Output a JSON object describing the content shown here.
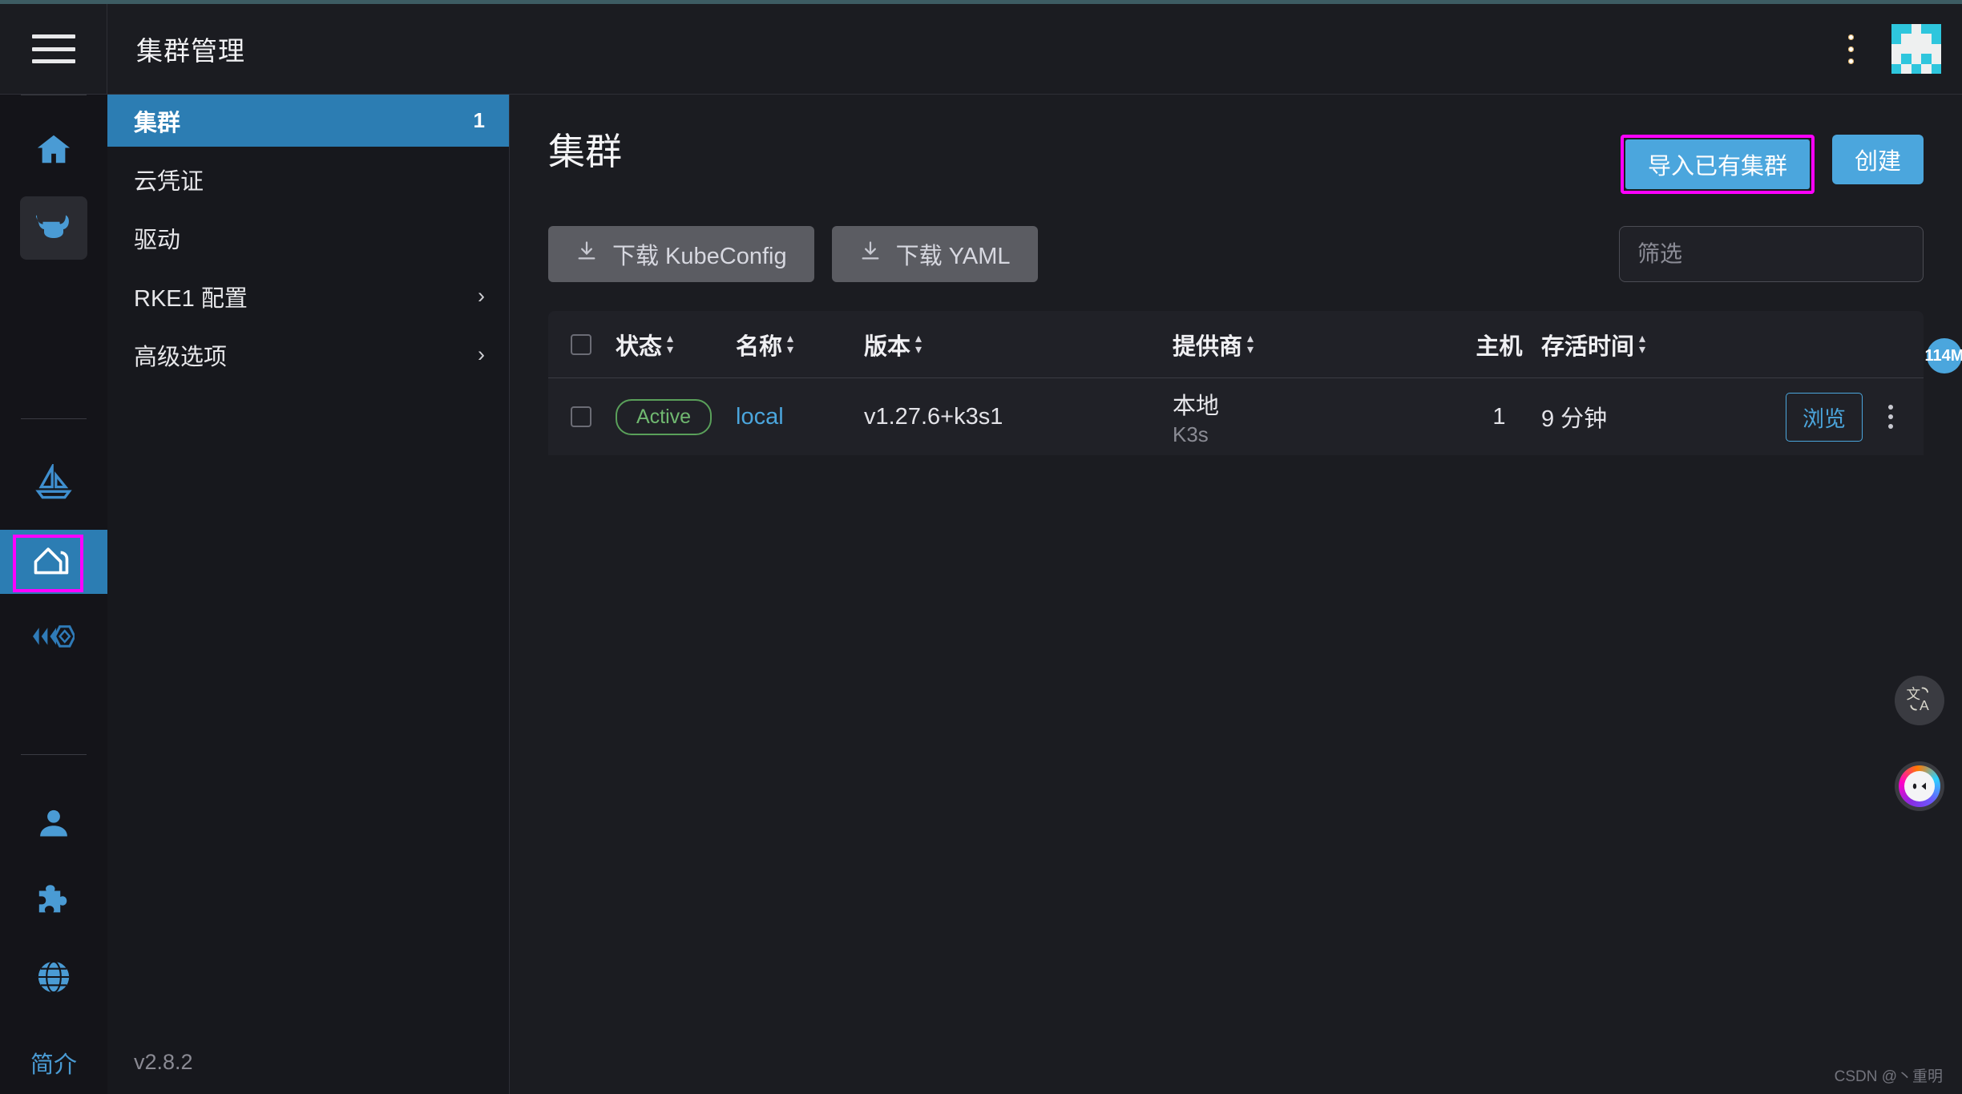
{
  "header": {
    "title": "集群管理",
    "menu_icon": "hamburger-icon",
    "kebab_icon": "vertical-dots-icon",
    "avatar_icon": "user-identicon"
  },
  "rail": {
    "items": [
      {
        "name": "home",
        "icon": "home-icon",
        "state": "default"
      },
      {
        "name": "cluster-explorer",
        "icon": "cow-head-icon",
        "state": "sub"
      },
      {
        "name": "fleet",
        "icon": "sailboat-icon",
        "state": "default"
      },
      {
        "name": "cluster-management",
        "icon": "barn-icon",
        "state": "active"
      },
      {
        "name": "mesh",
        "icon": "mesh-icon",
        "state": "default"
      },
      {
        "name": "users",
        "icon": "person-icon",
        "state": "default"
      },
      {
        "name": "extensions",
        "icon": "puzzle-icon",
        "state": "default"
      },
      {
        "name": "global-settings",
        "icon": "globe-icon",
        "state": "default"
      }
    ],
    "about_label": "简介"
  },
  "subnav": {
    "items": [
      {
        "label": "集群",
        "count": "1",
        "selected": true,
        "expandable": false
      },
      {
        "label": "云凭证",
        "count": "",
        "selected": false,
        "expandable": false
      },
      {
        "label": "驱动",
        "count": "",
        "selected": false,
        "expandable": false
      },
      {
        "label": "RKE1 配置",
        "count": "",
        "selected": false,
        "expandable": true
      },
      {
        "label": "高级选项",
        "count": "",
        "selected": false,
        "expandable": true
      }
    ],
    "chevron_glyph": "›",
    "version": "v2.8.2"
  },
  "main": {
    "page_title": "集群",
    "import_button": "导入已有集群",
    "create_button": "创建",
    "download_kubeconfig": "下载 KubeConfig",
    "download_yaml": "下载 YAML",
    "download_icon": "download-icon",
    "filter_placeholder": "筛选"
  },
  "table": {
    "columns": [
      {
        "label": "状态",
        "sortable": true
      },
      {
        "label": "名称",
        "sortable": true
      },
      {
        "label": "版本",
        "sortable": true
      },
      {
        "label": "提供商",
        "sortable": true
      },
      {
        "label": "主机",
        "sortable": false
      },
      {
        "label": "存活时间",
        "sortable": true
      }
    ],
    "rows": [
      {
        "state": "Active",
        "name": "local",
        "version": "v1.27.6+k3s1",
        "provider_main": "本地",
        "provider_sub": "K3s",
        "hosts": "1",
        "age": "9 分钟",
        "action_label": "浏览"
      }
    ]
  },
  "floating": {
    "memory_badge": "114M",
    "translate_icon": "translate-icon",
    "translate_glyphs": {
      "cjk": "文",
      "latin": "A"
    },
    "chat_icon": "chat-assistant-icon"
  },
  "watermark": "CSDN @丶重明",
  "colors": {
    "accent_blue": "#4ba6dd",
    "nav_selected": "#2c7db3",
    "highlight_magenta": "#ff00ff",
    "status_green": "#70b870",
    "panel_bg": "#1b1c21",
    "table_bg": "#202127",
    "rail_bg": "#141419"
  }
}
